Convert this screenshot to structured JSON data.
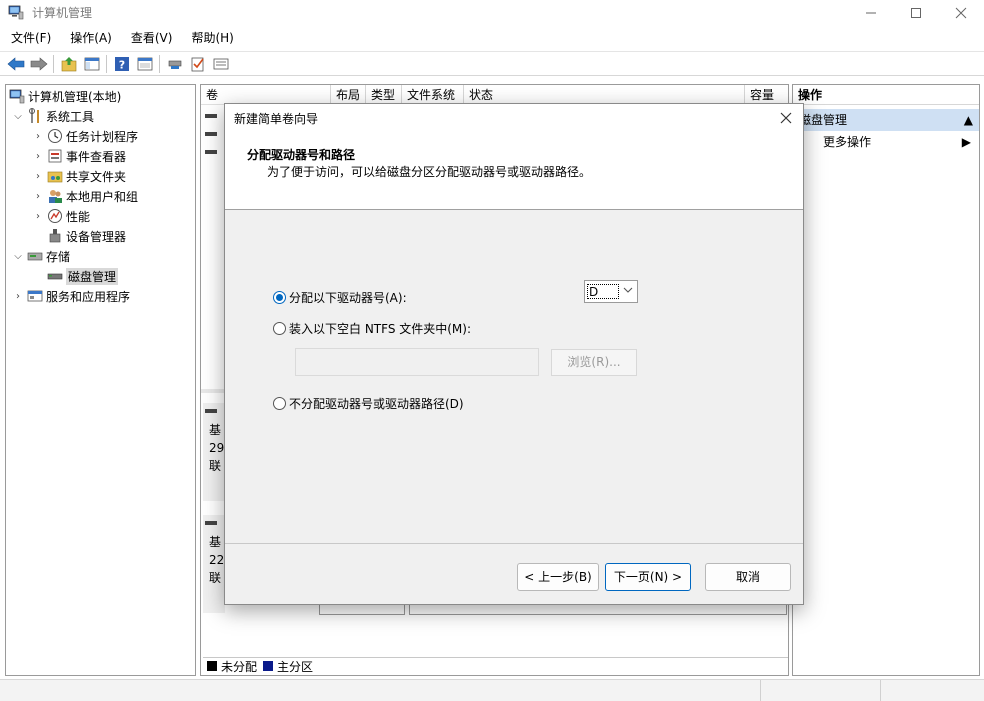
{
  "window": {
    "title": "计算机管理"
  },
  "menubar": [
    "文件(F)",
    "操作(A)",
    "查看(V)",
    "帮助(H)"
  ],
  "tree": {
    "root": "计算机管理(本地)",
    "system_tools": "系统工具",
    "task_scheduler": "任务计划程序",
    "event_viewer": "事件查看器",
    "shared_folders": "共享文件夹",
    "local_users": "本地用户和组",
    "performance": "性能",
    "device_manager": "设备管理器",
    "storage": "存储",
    "disk_management": "磁盘管理",
    "services_apps": "服务和应用程序"
  },
  "volume_table": {
    "columns": [
      "卷",
      "布局",
      "类型",
      "文件系统",
      "状态",
      "容量"
    ]
  },
  "disks": [
    {
      "l1": "基",
      "l2": "29",
      "l3": "联"
    },
    {
      "l1": "基",
      "l2": "22",
      "l3": "联"
    }
  ],
  "legend": {
    "unallocated": "未分配",
    "primary": "主分区",
    "colors": {
      "unallocated": "#000000",
      "primary": "#0a1a8a"
    }
  },
  "actions": {
    "header": "操作",
    "section": "磁盘管理",
    "more": "更多操作"
  },
  "dialog": {
    "title": "新建简单卷向导",
    "heading": "分配驱动器号和路径",
    "subheading": "为了便于访问，可以给磁盘分区分配驱动器号或驱动器路径。",
    "option_assign": "分配以下驱动器号(A):",
    "drive_letter": "D",
    "option_mount": "装入以下空白 NTFS 文件夹中(M):",
    "browse": "浏览(R)...",
    "option_none": "不分配驱动器号或驱动器路径(D)",
    "back": "< 上一步(B)",
    "next": "下一页(N) >",
    "cancel": "取消",
    "selected_option": "assign"
  }
}
